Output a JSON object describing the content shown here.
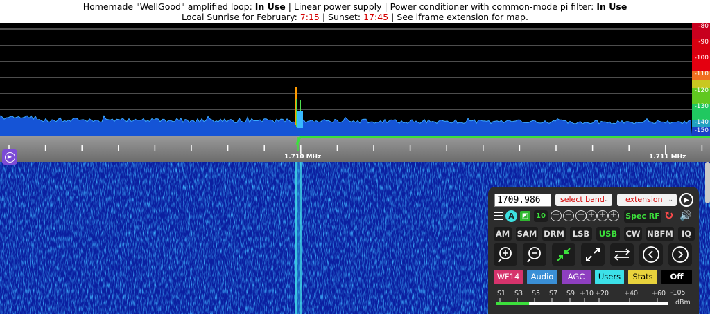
{
  "banner": {
    "line1": {
      "t1": "Homemade \"WellGood\" amplified loop: ",
      "b1": "In Use",
      "t2": " | Linear power supply | Power conditioner with common-mode pi filter: ",
      "b2": "In Use"
    },
    "line2": {
      "t1": "Local Sunrise for February: ",
      "sunrise": "7:15",
      "t2": " | Sunset: ",
      "sunset": "17:45",
      "t3": " | See iframe extension for map."
    }
  },
  "db_scale": [
    "-80",
    "-90",
    "-100",
    "-110",
    "-120",
    "-130",
    "-140",
    "-150"
  ],
  "ruler": {
    "freq_labels": [
      "1.710 MHz",
      "1.711 MHz"
    ]
  },
  "panel": {
    "frequency": "1709.986",
    "select_band": "select band",
    "extension": "extension",
    "a_label": "A",
    "ten_label": "10",
    "spec_label": "Spec RF",
    "modes": [
      "AM",
      "SAM",
      "DRM",
      "LSB",
      "USB",
      "CW",
      "NBFM",
      "IQ"
    ],
    "active_mode": "USB",
    "tabs": [
      "WF14",
      "Audio",
      "AGC",
      "Users",
      "Stats",
      "Off"
    ],
    "smeter_labels": [
      "S1",
      "S3",
      "S5",
      "S7",
      "S9",
      "+10",
      "+20",
      "+40",
      "+60",
      "-105"
    ],
    "smeter_unit": "dBm",
    "smeter_level": 0.19
  },
  "colors": {
    "accent_green": "#3ce03c",
    "sunrise_red": "#d40000",
    "tab_wf": "#d6336c",
    "tab_audio": "#3a8fd6",
    "tab_agc": "#8e3fc0",
    "tab_users": "#3ce0e8",
    "tab_stats": "#e8d23c",
    "tab_off": "#000000"
  }
}
